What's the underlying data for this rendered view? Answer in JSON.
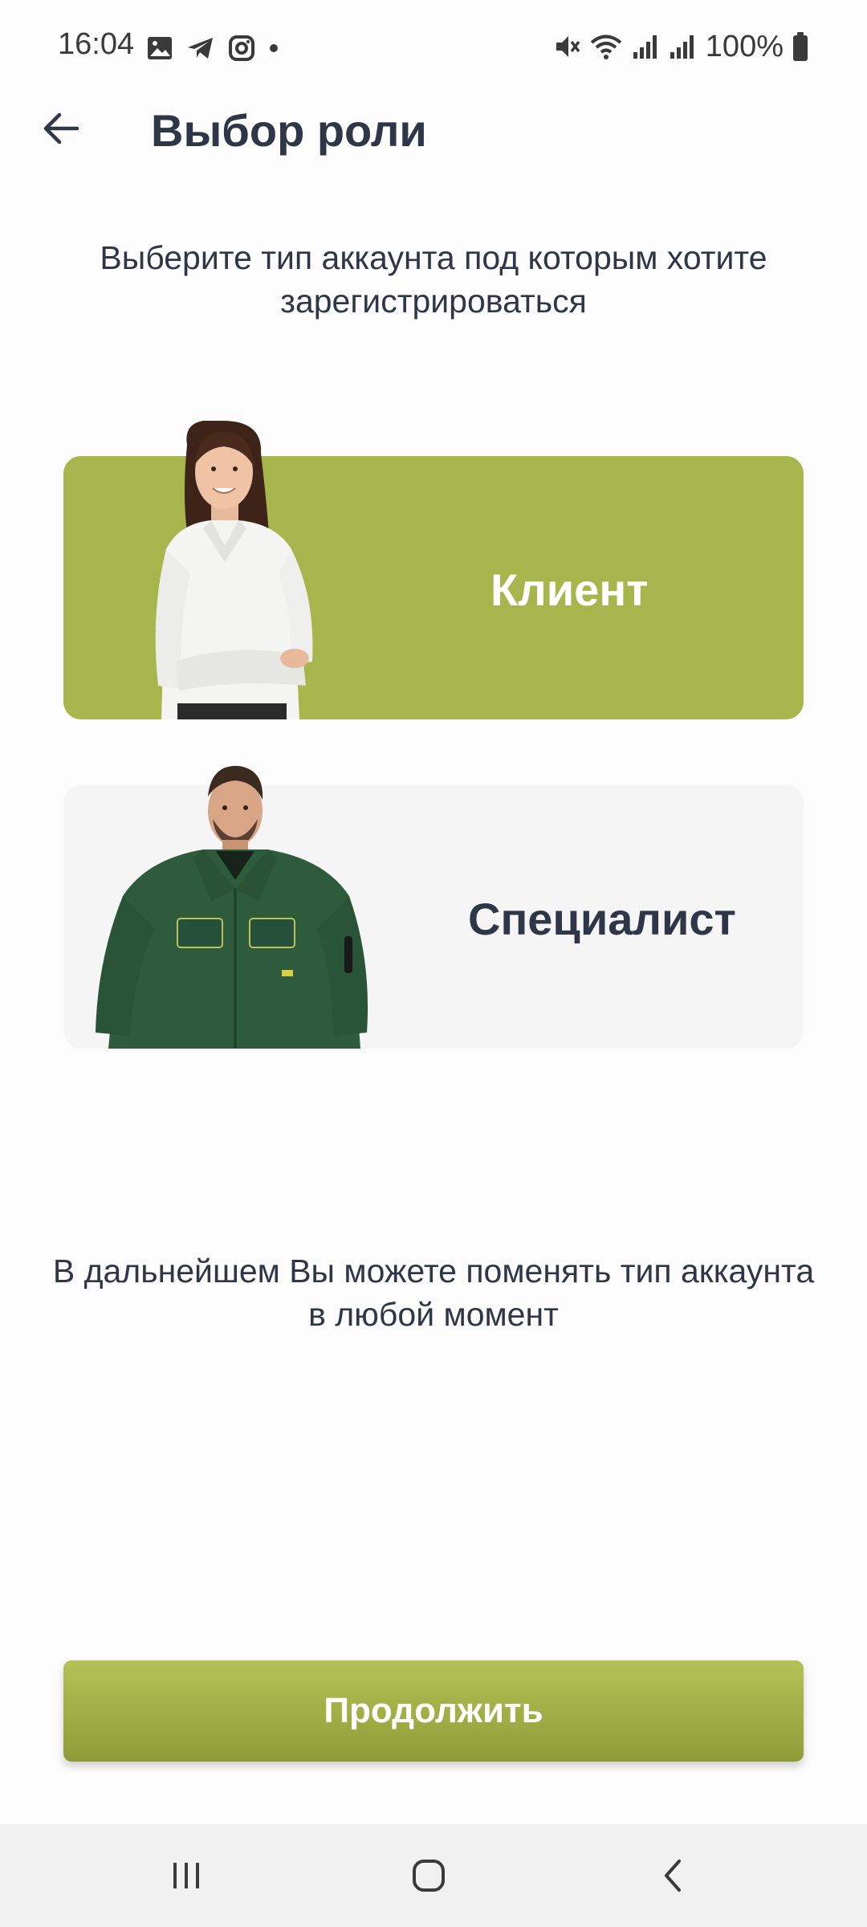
{
  "status_bar": {
    "time": "16:04",
    "battery": "100%",
    "left_icons": [
      "image-icon",
      "telegram-icon",
      "instagram-icon",
      "dot-icon"
    ],
    "right_icons": [
      "mute-icon",
      "wifi-icon",
      "signal-icon",
      "signal-icon",
      "battery-icon"
    ]
  },
  "header": {
    "back_icon": "arrow-left-icon",
    "title": "Выбор роли"
  },
  "subtitle": "Выберите тип аккаунта под которым хотите зарегистрироваться",
  "roles": [
    {
      "label": "Клиент",
      "selected": true,
      "accent": "#a6b64d"
    },
    {
      "label": "Специалист",
      "selected": false,
      "accent": "#f5f5f6"
    }
  ],
  "info": "В дальнейшем Вы можете поменять тип аккаунта в любой момент",
  "continue_label": "Продолжить",
  "nav_bar": {
    "icons": [
      "recent-apps-icon",
      "home-icon",
      "back-icon"
    ]
  },
  "colors": {
    "accent": "#a6b64d",
    "text": "#2f3648"
  }
}
